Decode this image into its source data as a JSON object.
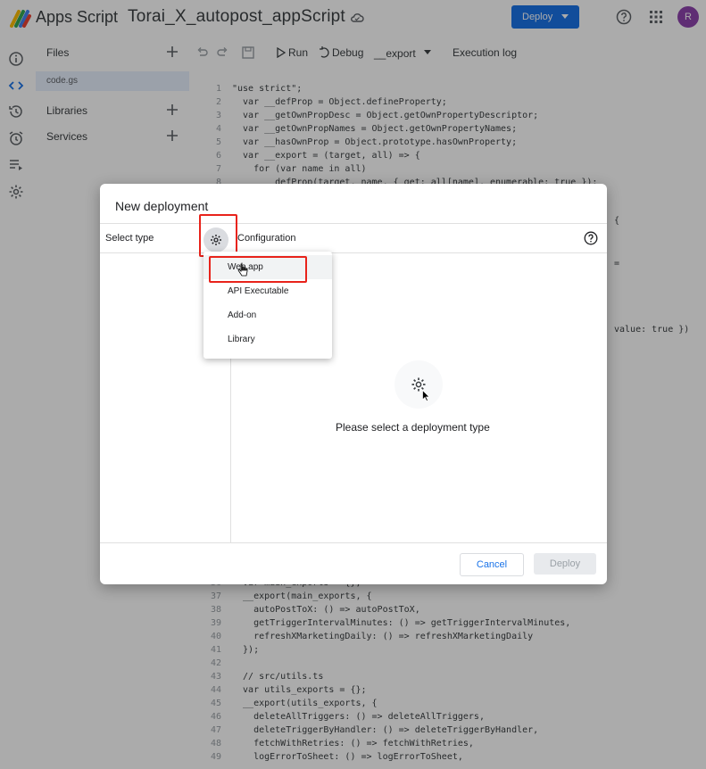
{
  "topbar": {
    "app_name": "Apps Script",
    "project_name": "Torai_X_autopost_appScript",
    "deploy_label": "Deploy",
    "avatar_letter": "R"
  },
  "files_panel": {
    "files_label": "Files",
    "file_name": "code.gs",
    "libraries_label": "Libraries",
    "services_label": "Services"
  },
  "toolbar": {
    "run_label": "Run",
    "debug_label": "Debug",
    "function_name": "__export",
    "execution_log_label": "Execution log"
  },
  "code": {
    "top_lines": [
      {
        "n": "1",
        "t": "\"use strict\";"
      },
      {
        "n": "2",
        "t": "  var __defProp = Object.defineProperty;"
      },
      {
        "n": "3",
        "t": "  var __getOwnPropDesc = Object.getOwnPropertyDescriptor;"
      },
      {
        "n": "4",
        "t": "  var __getOwnPropNames = Object.getOwnPropertyNames;"
      },
      {
        "n": "5",
        "t": "  var __hasOwnProp = Object.prototype.hasOwnProperty;"
      },
      {
        "n": "6",
        "t": "  var __export = (target, all) => {"
      },
      {
        "n": "7",
        "t": "    for (var name in all)"
      },
      {
        "n": "8",
        "t": "      __defProp(target, name, { get: all[name], enumerable: true });"
      }
    ],
    "side_fragments": [
      "{",
      "=",
      "value: true })"
    ],
    "bottom_lines": [
      {
        "n": "36",
        "t": "  var main_exports = {};"
      },
      {
        "n": "37",
        "t": "  __export(main_exports, {"
      },
      {
        "n": "38",
        "t": "    autoPostToX: () => autoPostToX,"
      },
      {
        "n": "39",
        "t": "    getTriggerIntervalMinutes: () => getTriggerIntervalMinutes,"
      },
      {
        "n": "40",
        "t": "    refreshXMarketingDaily: () => refreshXMarketingDaily"
      },
      {
        "n": "41",
        "t": "  });"
      },
      {
        "n": "42",
        "t": ""
      },
      {
        "n": "43",
        "t": "  // src/utils.ts"
      },
      {
        "n": "44",
        "t": "  var utils_exports = {};"
      },
      {
        "n": "45",
        "t": "  __export(utils_exports, {"
      },
      {
        "n": "46",
        "t": "    deleteAllTriggers: () => deleteAllTriggers,"
      },
      {
        "n": "47",
        "t": "    deleteTriggerByHandler: () => deleteTriggerByHandler,"
      },
      {
        "n": "48",
        "t": "    fetchWithRetries: () => fetchWithRetries,"
      },
      {
        "n": "49",
        "t": "    logErrorToSheet: () => logErrorToSheet,"
      }
    ]
  },
  "dialog": {
    "title": "New deployment",
    "select_type_label": "Select type",
    "configuration_label": "Configuration",
    "empty_message": "Please select a deployment type",
    "cancel_label": "Cancel",
    "deploy_label": "Deploy"
  },
  "type_menu": {
    "items": [
      {
        "label": "Web app"
      },
      {
        "label": "API Executable"
      },
      {
        "label": "Add-on"
      },
      {
        "label": "Library"
      }
    ]
  },
  "colors": {
    "accent": "#1a73e8",
    "highlight": "#e8231b",
    "overlay": "rgba(0,0,0,0.33)"
  }
}
